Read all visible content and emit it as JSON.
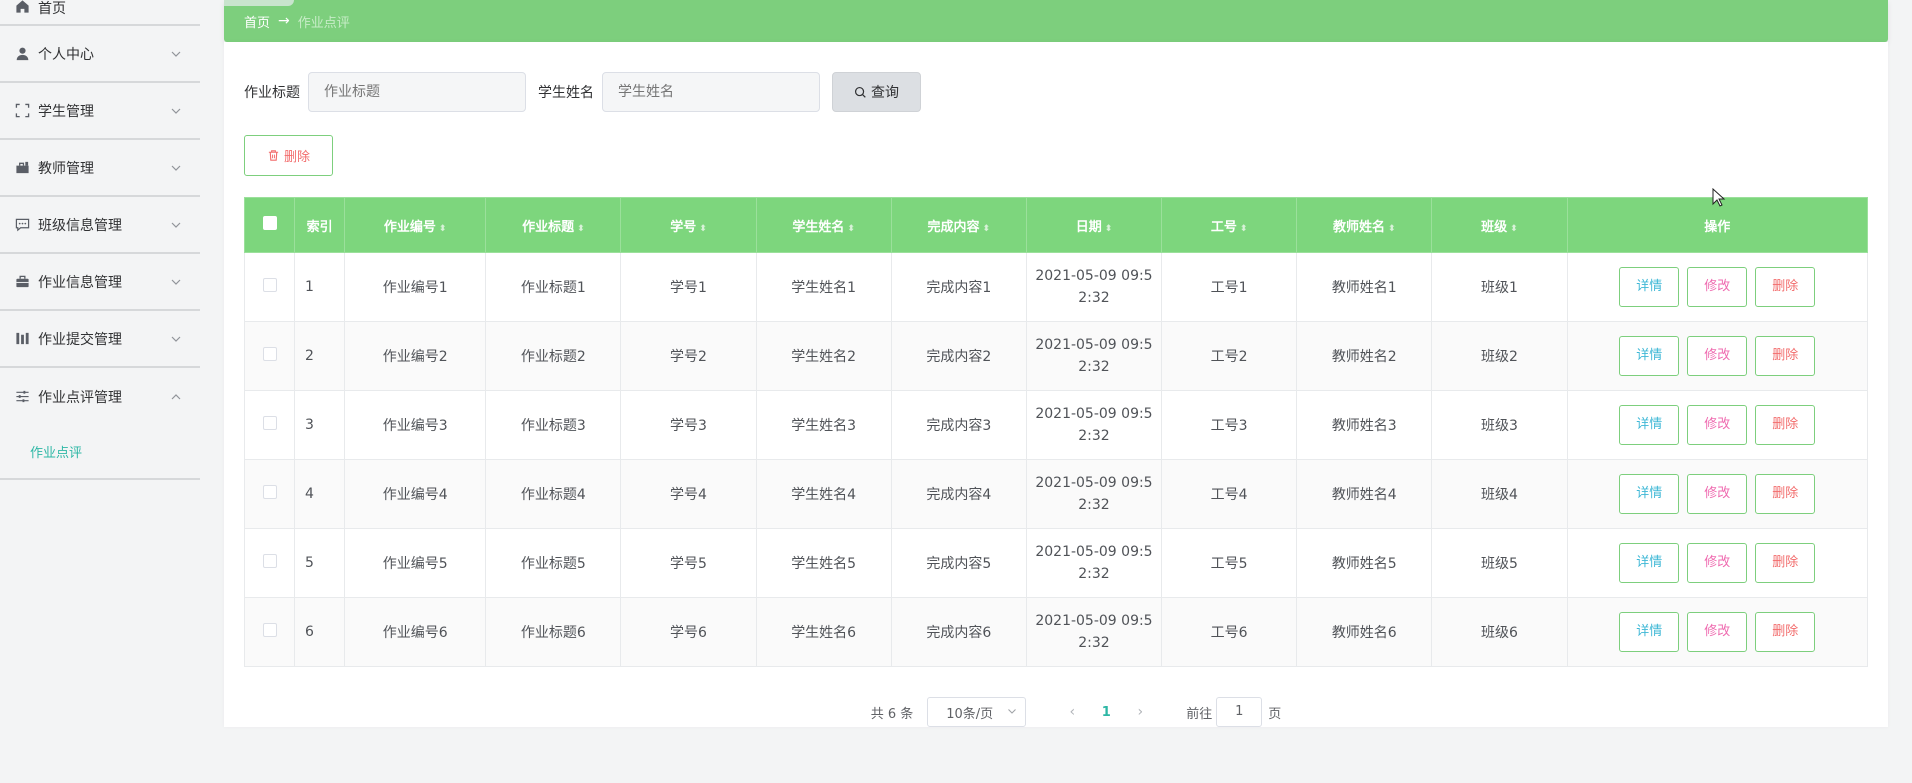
{
  "sidebar": {
    "items": [
      {
        "label": "首页",
        "icon": "home-icon"
      },
      {
        "label": "个人中心",
        "icon": "user-icon"
      },
      {
        "label": "学生管理",
        "icon": "fullscreen-icon"
      },
      {
        "label": "教师管理",
        "icon": "briefcase-icon"
      },
      {
        "label": "班级信息管理",
        "icon": "chat-icon"
      },
      {
        "label": "作业信息管理",
        "icon": "suitcase-icon"
      },
      {
        "label": "作业提交管理",
        "icon": "chart-icon"
      },
      {
        "label": "作业点评管理",
        "icon": "sliders-icon"
      }
    ],
    "sub_item": "作业点评"
  },
  "breadcrumb": {
    "home": "首页",
    "separator": "→",
    "current": "作业点评"
  },
  "search": {
    "title_label": "作业标题",
    "title_placeholder": "作业标题",
    "name_label": "学生姓名",
    "name_placeholder": "学生姓名",
    "query_button": "查询"
  },
  "toolbar": {
    "delete_label": "删除"
  },
  "table": {
    "headers": [
      "索引",
      "作业编号",
      "作业标题",
      "学号",
      "学生姓名",
      "完成内容",
      "日期",
      "工号",
      "教师姓名",
      "班级",
      "操作"
    ],
    "rows": [
      {
        "index": "1",
        "hw_no": "作业编号1",
        "hw_title": "作业标题1",
        "student_no": "学号1",
        "student_name": "学生姓名1",
        "content": "完成内容1",
        "date_1": "2021-05-09 09:5",
        "date_2": "2:32",
        "work_no": "工号1",
        "teacher": "教师姓名1",
        "class": "班级1"
      },
      {
        "index": "2",
        "hw_no": "作业编号2",
        "hw_title": "作业标题2",
        "student_no": "学号2",
        "student_name": "学生姓名2",
        "content": "完成内容2",
        "date_1": "2021-05-09 09:5",
        "date_2": "2:32",
        "work_no": "工号2",
        "teacher": "教师姓名2",
        "class": "班级2"
      },
      {
        "index": "3",
        "hw_no": "作业编号3",
        "hw_title": "作业标题3",
        "student_no": "学号3",
        "student_name": "学生姓名3",
        "content": "完成内容3",
        "date_1": "2021-05-09 09:5",
        "date_2": "2:32",
        "work_no": "工号3",
        "teacher": "教师姓名3",
        "class": "班级3"
      },
      {
        "index": "4",
        "hw_no": "作业编号4",
        "hw_title": "作业标题4",
        "student_no": "学号4",
        "student_name": "学生姓名4",
        "content": "完成内容4",
        "date_1": "2021-05-09 09:5",
        "date_2": "2:32",
        "work_no": "工号4",
        "teacher": "教师姓名4",
        "class": "班级4"
      },
      {
        "index": "5",
        "hw_no": "作业编号5",
        "hw_title": "作业标题5",
        "student_no": "学号5",
        "student_name": "学生姓名5",
        "content": "完成内容5",
        "date_1": "2021-05-09 09:5",
        "date_2": "2:32",
        "work_no": "工号5",
        "teacher": "教师姓名5",
        "class": "班级5"
      },
      {
        "index": "6",
        "hw_no": "作业编号6",
        "hw_title": "作业标题6",
        "student_no": "学号6",
        "student_name": "学生姓名6",
        "content": "完成内容6",
        "date_1": "2021-05-09 09:5",
        "date_2": "2:32",
        "work_no": "工号6",
        "teacher": "教师姓名6",
        "class": "班级6"
      }
    ],
    "actions": {
      "detail": "详情",
      "edit": "修改",
      "delete": "删除"
    }
  },
  "pagination": {
    "total": "共 6 条",
    "page_size": "10条/页",
    "current_page": "1",
    "goto_prefix": "前往",
    "goto_value": "1",
    "goto_suffix": "页"
  },
  "colors": {
    "accent_green": "#7dd67d",
    "teal_text": "#2db7a5",
    "danger_red": "#f26b6b",
    "edit_pink": "#ef6bb0",
    "detail_blue": "#3fb8d6"
  }
}
